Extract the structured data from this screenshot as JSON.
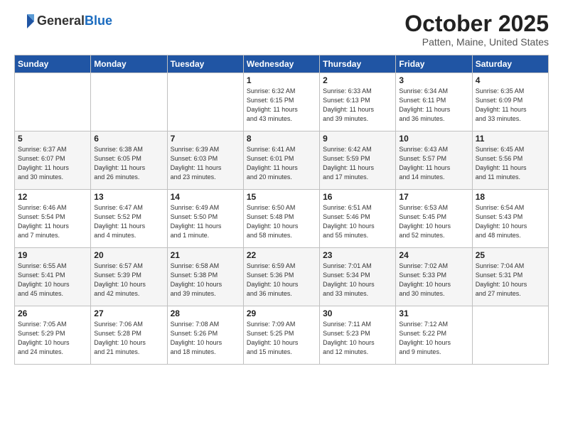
{
  "header": {
    "logo_general": "General",
    "logo_blue": "Blue",
    "title": "October 2025",
    "subtitle": "Patten, Maine, United States"
  },
  "days_of_week": [
    "Sunday",
    "Monday",
    "Tuesday",
    "Wednesday",
    "Thursday",
    "Friday",
    "Saturday"
  ],
  "weeks": [
    [
      {
        "num": "",
        "detail": ""
      },
      {
        "num": "",
        "detail": ""
      },
      {
        "num": "",
        "detail": ""
      },
      {
        "num": "1",
        "detail": "Sunrise: 6:32 AM\nSunset: 6:15 PM\nDaylight: 11 hours\nand 43 minutes."
      },
      {
        "num": "2",
        "detail": "Sunrise: 6:33 AM\nSunset: 6:13 PM\nDaylight: 11 hours\nand 39 minutes."
      },
      {
        "num": "3",
        "detail": "Sunrise: 6:34 AM\nSunset: 6:11 PM\nDaylight: 11 hours\nand 36 minutes."
      },
      {
        "num": "4",
        "detail": "Sunrise: 6:35 AM\nSunset: 6:09 PM\nDaylight: 11 hours\nand 33 minutes."
      }
    ],
    [
      {
        "num": "5",
        "detail": "Sunrise: 6:37 AM\nSunset: 6:07 PM\nDaylight: 11 hours\nand 30 minutes."
      },
      {
        "num": "6",
        "detail": "Sunrise: 6:38 AM\nSunset: 6:05 PM\nDaylight: 11 hours\nand 26 minutes."
      },
      {
        "num": "7",
        "detail": "Sunrise: 6:39 AM\nSunset: 6:03 PM\nDaylight: 11 hours\nand 23 minutes."
      },
      {
        "num": "8",
        "detail": "Sunrise: 6:41 AM\nSunset: 6:01 PM\nDaylight: 11 hours\nand 20 minutes."
      },
      {
        "num": "9",
        "detail": "Sunrise: 6:42 AM\nSunset: 5:59 PM\nDaylight: 11 hours\nand 17 minutes."
      },
      {
        "num": "10",
        "detail": "Sunrise: 6:43 AM\nSunset: 5:57 PM\nDaylight: 11 hours\nand 14 minutes."
      },
      {
        "num": "11",
        "detail": "Sunrise: 6:45 AM\nSunset: 5:56 PM\nDaylight: 11 hours\nand 11 minutes."
      }
    ],
    [
      {
        "num": "12",
        "detail": "Sunrise: 6:46 AM\nSunset: 5:54 PM\nDaylight: 11 hours\nand 7 minutes."
      },
      {
        "num": "13",
        "detail": "Sunrise: 6:47 AM\nSunset: 5:52 PM\nDaylight: 11 hours\nand 4 minutes."
      },
      {
        "num": "14",
        "detail": "Sunrise: 6:49 AM\nSunset: 5:50 PM\nDaylight: 11 hours\nand 1 minute."
      },
      {
        "num": "15",
        "detail": "Sunrise: 6:50 AM\nSunset: 5:48 PM\nDaylight: 10 hours\nand 58 minutes."
      },
      {
        "num": "16",
        "detail": "Sunrise: 6:51 AM\nSunset: 5:46 PM\nDaylight: 10 hours\nand 55 minutes."
      },
      {
        "num": "17",
        "detail": "Sunrise: 6:53 AM\nSunset: 5:45 PM\nDaylight: 10 hours\nand 52 minutes."
      },
      {
        "num": "18",
        "detail": "Sunrise: 6:54 AM\nSunset: 5:43 PM\nDaylight: 10 hours\nand 48 minutes."
      }
    ],
    [
      {
        "num": "19",
        "detail": "Sunrise: 6:55 AM\nSunset: 5:41 PM\nDaylight: 10 hours\nand 45 minutes."
      },
      {
        "num": "20",
        "detail": "Sunrise: 6:57 AM\nSunset: 5:39 PM\nDaylight: 10 hours\nand 42 minutes."
      },
      {
        "num": "21",
        "detail": "Sunrise: 6:58 AM\nSunset: 5:38 PM\nDaylight: 10 hours\nand 39 minutes."
      },
      {
        "num": "22",
        "detail": "Sunrise: 6:59 AM\nSunset: 5:36 PM\nDaylight: 10 hours\nand 36 minutes."
      },
      {
        "num": "23",
        "detail": "Sunrise: 7:01 AM\nSunset: 5:34 PM\nDaylight: 10 hours\nand 33 minutes."
      },
      {
        "num": "24",
        "detail": "Sunrise: 7:02 AM\nSunset: 5:33 PM\nDaylight: 10 hours\nand 30 minutes."
      },
      {
        "num": "25",
        "detail": "Sunrise: 7:04 AM\nSunset: 5:31 PM\nDaylight: 10 hours\nand 27 minutes."
      }
    ],
    [
      {
        "num": "26",
        "detail": "Sunrise: 7:05 AM\nSunset: 5:29 PM\nDaylight: 10 hours\nand 24 minutes."
      },
      {
        "num": "27",
        "detail": "Sunrise: 7:06 AM\nSunset: 5:28 PM\nDaylight: 10 hours\nand 21 minutes."
      },
      {
        "num": "28",
        "detail": "Sunrise: 7:08 AM\nSunset: 5:26 PM\nDaylight: 10 hours\nand 18 minutes."
      },
      {
        "num": "29",
        "detail": "Sunrise: 7:09 AM\nSunset: 5:25 PM\nDaylight: 10 hours\nand 15 minutes."
      },
      {
        "num": "30",
        "detail": "Sunrise: 7:11 AM\nSunset: 5:23 PM\nDaylight: 10 hours\nand 12 minutes."
      },
      {
        "num": "31",
        "detail": "Sunrise: 7:12 AM\nSunset: 5:22 PM\nDaylight: 10 hours\nand 9 minutes."
      },
      {
        "num": "",
        "detail": ""
      }
    ]
  ]
}
